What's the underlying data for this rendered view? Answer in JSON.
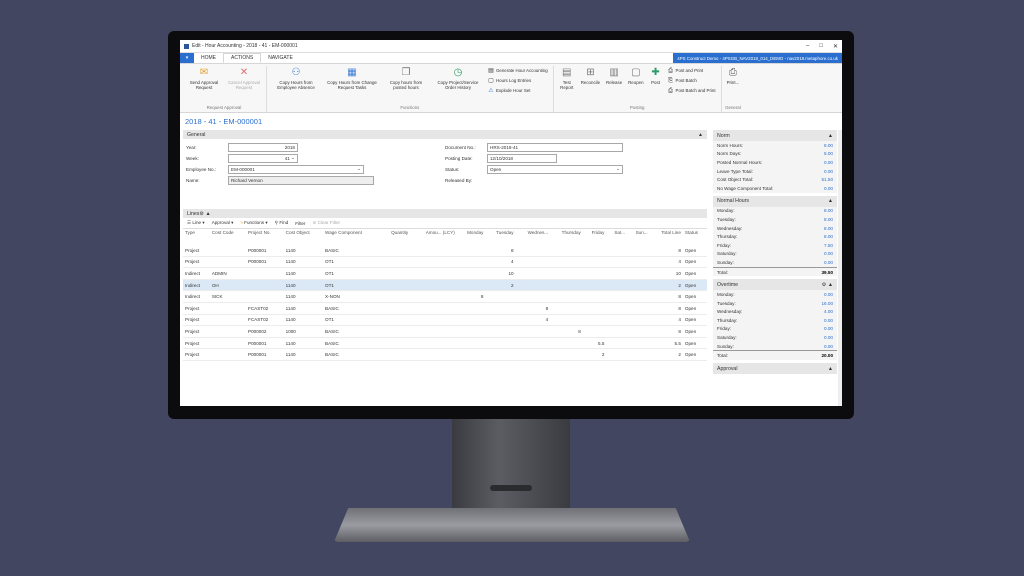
{
  "window": {
    "title": "Edit - Hour Accounting - 2018 - 41 - EM-000001"
  },
  "ribbon": {
    "file_label": "▾",
    "tabs": [
      {
        "label": "HOME"
      },
      {
        "label": "ACTIONS"
      },
      {
        "label": "NAVIGATE"
      }
    ],
    "company": "4PS Construct Demo - 4PSGB_NAV2018_014_DEMO - nav2018.metaphore.co.uk",
    "request_approval": {
      "name": "Request Approval",
      "send": "Send Approval Request",
      "cancel": "Cancel Approval Request"
    },
    "functions": {
      "name": "Functions",
      "copy_absence": "Copy Hours from Employee Absence",
      "copy_change": "Copy Hours from Change Request Tasks",
      "copy_posted": "Copy hours from posted hours",
      "copy_project": "Copy Project/Service Order History",
      "generate": "Generate Hour Accounting",
      "hours_log": "Hours Log Entries",
      "explode": "Explode Hour Set"
    },
    "posting": {
      "name": "Posting",
      "test_report": "Test Report",
      "reconcile": "Reconcile",
      "release": "Release",
      "reopen": "Reopen",
      "post": "Post",
      "post_print": "Post and Print",
      "post_batch": "Post Batch",
      "post_batch_print": "Post Batch and Print"
    },
    "general": {
      "name": "General",
      "print": "Print..."
    }
  },
  "page_title": "2018 - 41 - EM-000001",
  "general": {
    "header": "General",
    "year_label": "Year:",
    "year": "2018",
    "week_label": "Week:",
    "week": "41",
    "employee_label": "Employee No.:",
    "employee": "EM-000001",
    "name_label": "Name:",
    "name": "Richard Vernon",
    "doc_label": "Document No.:",
    "doc": "HRS-2018-41",
    "posting_label": "Posting Date:",
    "posting": "12/10/2018",
    "status_label": "Status:",
    "status": "Open",
    "released_label": "Released By:"
  },
  "lines": {
    "header": "Lines",
    "toolbar": {
      "line": "Line",
      "approval": "Approval",
      "functions": "Functions",
      "find": "Find",
      "filter": "Filter",
      "clear_filter": "Clear Filter"
    },
    "columns": [
      "Type",
      "Cost Code",
      "Project No.",
      "Cost Object",
      "Wage Component",
      "Quantity",
      "Amou... (LCY)",
      "Monday",
      "Tuesday",
      "Wednes...",
      "Thursday",
      "Friday",
      "Sat...",
      "Sun...",
      "Total Line",
      "Status"
    ],
    "rows": [
      [
        "Project",
        "",
        "P000001",
        "1140",
        "BASIC",
        "",
        "",
        "",
        "8",
        "",
        "",
        "",
        "",
        "",
        "8",
        "Open"
      ],
      [
        "Project",
        "",
        "P000001",
        "1140",
        "OT1",
        "",
        "",
        "",
        "4",
        "",
        "",
        "",
        "",
        "",
        "4",
        "Open"
      ],
      [
        "Indirect",
        "ADMIN",
        "",
        "1140",
        "OT1",
        "",
        "",
        "",
        "10",
        "",
        "",
        "",
        "",
        "",
        "10",
        "Open"
      ],
      [
        "Indirect",
        "OH",
        "",
        "1140",
        "OT1",
        "",
        "",
        "",
        "2",
        "",
        "",
        "",
        "",
        "",
        "2",
        "Open"
      ],
      [
        "Indirect",
        "SICK",
        "",
        "1140",
        "X-NON",
        "",
        "",
        "8",
        "",
        "",
        "",
        "",
        "",
        "",
        "8",
        "Open"
      ],
      [
        "Project",
        "",
        "FCAST02",
        "1140",
        "BASIC",
        "",
        "",
        "",
        "",
        "8",
        "",
        "",
        "",
        "",
        "8",
        "Open"
      ],
      [
        "Project",
        "",
        "FCAST02",
        "1140",
        "OT1",
        "",
        "",
        "",
        "",
        "4",
        "",
        "",
        "",
        "",
        "4",
        "Open"
      ],
      [
        "Project",
        "",
        "P000002",
        "1000",
        "BASIC",
        "",
        "",
        "",
        "",
        "",
        "8",
        "",
        "",
        "",
        "8",
        "Open"
      ],
      [
        "Project",
        "",
        "P000001",
        "1140",
        "BASIC",
        "",
        "",
        "",
        "",
        "",
        "",
        "5.5",
        "",
        "",
        "5.5",
        "Open"
      ],
      [
        "Project",
        "",
        "P000001",
        "1140",
        "BASIC",
        "",
        "",
        "",
        "",
        "",
        "",
        "2",
        "",
        "",
        "2",
        "Open"
      ]
    ]
  },
  "norm": {
    "header": "Norm",
    "rows": [
      {
        "k": "Norm Hours:",
        "v": "8.00"
      },
      {
        "k": "Norm Days:",
        "v": "5.00"
      },
      {
        "k": "Posted Normal Hours:",
        "v": "0.00"
      },
      {
        "k": "Leave Type Total:",
        "v": "0.00"
      },
      {
        "k": "Cost Object Total:",
        "v": "51.50"
      },
      {
        "k": "No Wage Component Total:",
        "v": "0.00"
      }
    ]
  },
  "normal_hours": {
    "header": "Normal Hours",
    "rows": [
      {
        "k": "Monday:",
        "v": "8.00"
      },
      {
        "k": "Tuesday:",
        "v": "8.00"
      },
      {
        "k": "Wednesday:",
        "v": "8.00"
      },
      {
        "k": "Thursday:",
        "v": "8.00"
      },
      {
        "k": "Friday:",
        "v": "7.50"
      },
      {
        "k": "Saturday:",
        "v": "0.00"
      },
      {
        "k": "Sunday:",
        "v": "0.00"
      }
    ],
    "total_label": "Total:",
    "total": "39.50"
  },
  "overtime": {
    "header": "Overtime",
    "rows": [
      {
        "k": "Monday:",
        "v": "0.00"
      },
      {
        "k": "Tuesday:",
        "v": "16.00"
      },
      {
        "k": "Wednesday:",
        "v": "4.00"
      },
      {
        "k": "Thursday:",
        "v": "0.00"
      },
      {
        "k": "Friday:",
        "v": "0.00"
      },
      {
        "k": "Saturday:",
        "v": "0.00"
      },
      {
        "k": "Sunday:",
        "v": "0.00"
      }
    ],
    "total_label": "Total:",
    "total": "20.00"
  },
  "approval": {
    "header": "Approval"
  }
}
